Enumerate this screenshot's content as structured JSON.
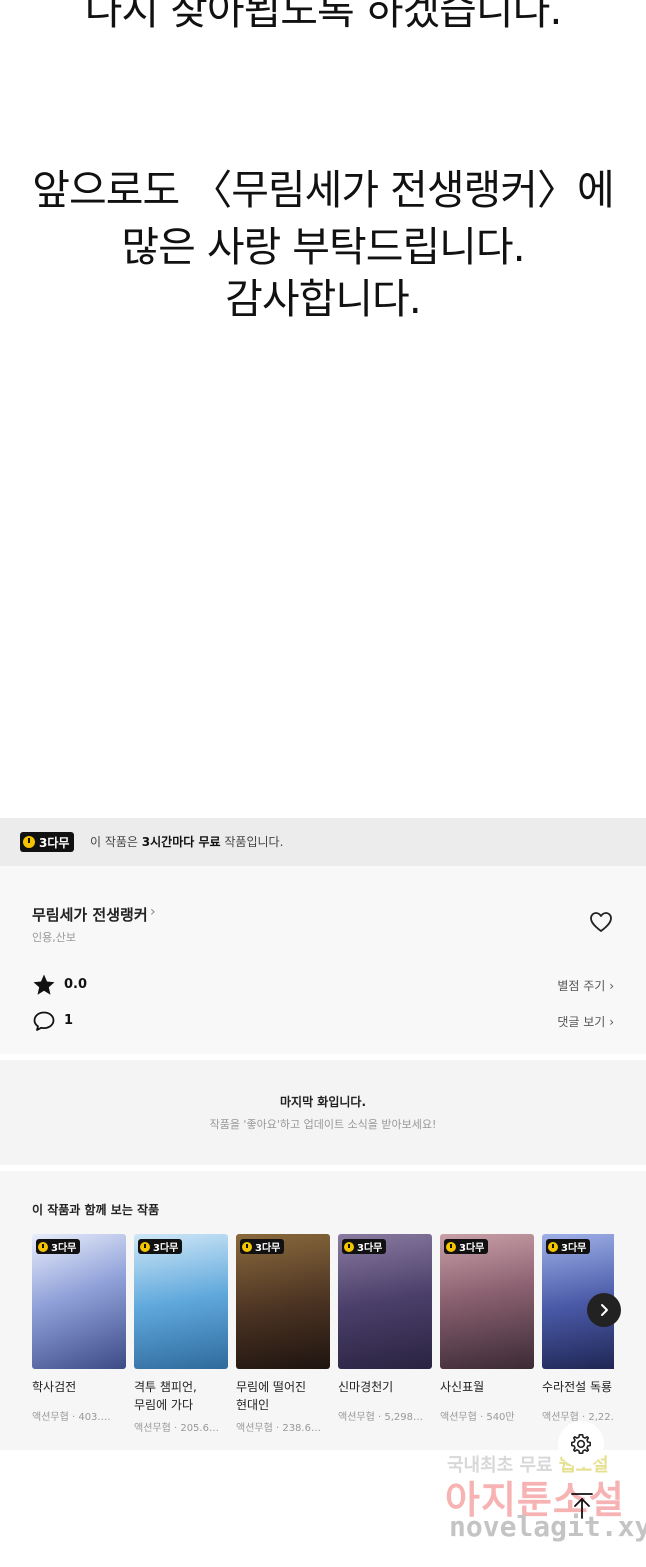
{
  "comic": {
    "lines": [
      "다시 찾아뵙도록 하겠습니다.",
      "앞으로도 〈무림세가 전생랭커〉에",
      "많은 사랑 부탁드립니다.",
      "감사합니다."
    ]
  },
  "free_bar": {
    "badge": "3다무",
    "text_pre": "이 작품은 ",
    "text_bold": "3시간마다 무료",
    "text_post": " 작품입니다."
  },
  "work": {
    "title": "무림세가 전생랭커",
    "authors": "인용,산보",
    "rating": "0.0",
    "rate_link": "별점 주기",
    "comment_count": "1",
    "comment_link": "댓글 보기"
  },
  "last_episode": {
    "title": "마지막 화입니다.",
    "subtitle": "작품을 '좋아요'하고 업데이트 소식을 받아보세요!"
  },
  "recommendations": {
    "heading": "이 작품과 함께 보는 작품",
    "items": [
      {
        "badge": "3다무",
        "title": "학사검전",
        "meta": "액션무협 · 403.…",
        "thumb_color": "#5b6ea8"
      },
      {
        "badge": "3다무",
        "title": "격투 챔피언, 무림에 가다",
        "meta": "액션무협 · 205.6…",
        "thumb_color": "#3f8ac4"
      },
      {
        "badge": "3다무",
        "title": "무림에 떨어진 현대인",
        "meta": "액션무협 · 238.6…",
        "thumb_color": "#6b4a2c"
      },
      {
        "badge": "3다무",
        "title": "신마경천기",
        "meta": "액션무협 · 5,298…",
        "thumb_color": "#4a3f6a"
      },
      {
        "badge": "3다무",
        "title": "사신표월",
        "meta": "액션무협 · 540만",
        "thumb_color": "#7a5a6a"
      },
      {
        "badge": "3다무",
        "title": "수라전설 독룡",
        "meta": "액션무협 · 2,22…",
        "thumb_color": "#3c4c8c"
      }
    ]
  },
  "watermark": {
    "line1_pre": "국내최초 무료 ",
    "line1_hl": "웹소설",
    "line2": "아지툰소설",
    "line3": "novelagit.xyz"
  }
}
